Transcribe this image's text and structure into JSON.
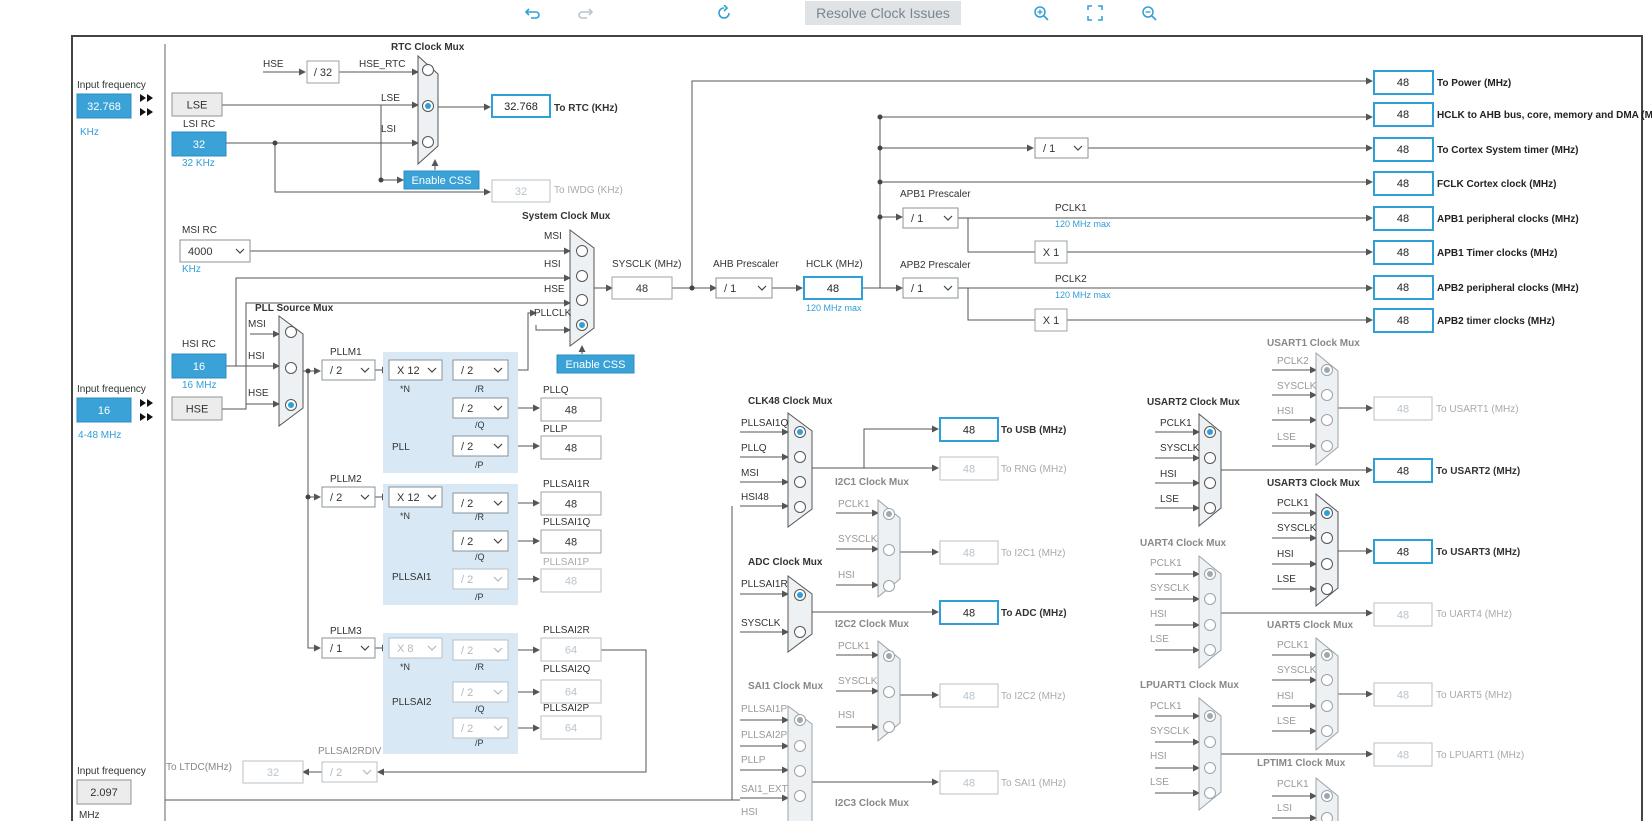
{
  "toolbar": {
    "undo_icon": "undo-icon",
    "redo_icon": "redo-icon",
    "refresh_icon": "refresh-icon",
    "resolve_label": "Resolve Clock Issues",
    "zoom_in_icon": "zoom-in-icon",
    "fit_icon": "fit-screen-icon",
    "zoom_out_icon": "zoom-out-icon"
  },
  "colors": {
    "accent": "#2f9fd8",
    "active_box": "#3aa2d7",
    "gray_box": "#ececec",
    "pll_bg": "#d8e9f5",
    "line": "#555555"
  },
  "labels": {
    "input_frequency": "Input frequency",
    "lse_freq": "32.768",
    "lse_unit": "KHz",
    "lse": "LSE",
    "lsi_rc": "LSI RC",
    "lsi_val": "32",
    "lsi_unit": "32 KHz",
    "hse": "HSE",
    "div32": "/ 32",
    "hse_rtc": "HSE_RTC",
    "lse_sig": "LSE",
    "lsi_sig": "LSI",
    "rtc_mux": "RTC Clock Mux",
    "rtc_val": "32.768",
    "to_rtc": "To RTC (KHz)",
    "enable_css": "Enable CSS",
    "iwdg_val": "32",
    "to_iwdg": "To IWDG (KHz)",
    "msi_rc": "MSI RC",
    "msi_val": "4000",
    "msi_unit": "KHz",
    "sys_mux": "System Clock Mux",
    "msi": "MSI",
    "hsi": "HSI",
    "hse_sig": "HSE",
    "pllclk": "PLLCLK",
    "sysclk": "SYSCLK (MHz)",
    "sysclk_val": "48",
    "ahb_presc": "AHB Prescaler",
    "ahb_val": "/ 1",
    "hclk": "HCLK (MHz)",
    "hclk_val": "48",
    "hclk_max": "120 MHz max",
    "apb1_presc": "APB1 Prescaler",
    "apb1_val": "/ 1",
    "apb2_presc": "APB2 Prescaler",
    "apb2_val": "/ 1",
    "pclk1": "PCLK1",
    "pclk1_max": "120 MHz max",
    "pclk2": "PCLK2",
    "pclk2_max": "120 MHz max",
    "x1": "X 1",
    "cortex_div": "/ 1",
    "hsi_rc": "HSI RC",
    "hsi_val": "16",
    "hsi_unit": "16 MHz",
    "hse_freq": "16",
    "hse_unit": "4-48 MHz",
    "pll_src_mux": "PLL Source Mux",
    "pllm1": "PLLM1",
    "pllm1_val": "/ 2",
    "pll_n_val": "X 12",
    "n_label": "*N",
    "div2": "/ 2",
    "r": "/R",
    "q": "/Q",
    "p": "/P",
    "pll": "PLL",
    "pllq": "PLLQ",
    "pllq_val": "48",
    "pllp": "PLLP",
    "pllp_val": "48",
    "pllm2": "PLLM2",
    "pllm2_val": "/ 2",
    "pllsai1_n": "X 12",
    "pllsai1": "PLLSAI1",
    "pllsai1r": "PLLSAI1R",
    "pllsai1r_val": "48",
    "pllsai1q": "PLLSAI1Q",
    "pllsai1q_val": "48",
    "pllsai1p": "PLLSAI1P",
    "pllsai1p_val": "48",
    "pllm3": "PLLM3",
    "pllm3_val": "/ 1",
    "pllsai2_n": "X 8",
    "pllsai2": "PLLSAI2",
    "pllsai2r": "PLLSAI2R",
    "pllsai2r_val": "64",
    "pllsai2q": "PLLSAI2Q",
    "pllsai2q_val": "64",
    "pllsai2p": "PLLSAI2P",
    "pllsai2p_val": "64",
    "pllsai2rdiv": "PLLSAI2RDIV",
    "pllsai2rdiv_val": "/ 2",
    "ltdc_val": "32",
    "to_ltdc": "To LTDC(MHz)",
    "input_freq3_val": "2.097",
    "mhz": "MHz",
    "clk48_mux": "CLK48 Clock Mux",
    "pllsai1q_sig": "PLLSAI1Q",
    "pllq_sig": "PLLQ",
    "msi_sig": "MSI",
    "hsi48": "HSI48",
    "usb_val": "48",
    "to_usb": "To USB (MHz)",
    "rng_val": "48",
    "to_rng": "To RNG (MHz)",
    "i2c1_mux": "I2C1 Clock Mux",
    "pclk1_sig": "PCLK1",
    "sysclk_sig": "SYSCLK",
    "hsi_sig": "HSI",
    "i2c1_val": "48",
    "to_i2c1": "To I2C1 (MHz)",
    "adc_mux": "ADC Clock Mux",
    "pllsai1r_sig": "PLLSAI1R",
    "adc_val": "48",
    "to_adc": "To ADC (MHz)",
    "i2c2_mux": "I2C2 Clock Mux",
    "i2c2_val": "48",
    "to_i2c2": "To I2C2 (MHz)",
    "sai1_mux": "SAI1 Clock Mux",
    "pllsai1p_sig": "PLLSAI1P",
    "pllsai2p_sig": "PLLSAI2P",
    "pllp_sig": "PLLP",
    "sai1_ext": "SAI1_EXT",
    "sai1_val": "48",
    "to_sai1": "To SAI1 (MHz)",
    "i2c3_mux": "I2C3 Clock Mux",
    "usart1_mux": "USART1 Clock Mux",
    "pclk2_sig": "PCLK2",
    "lse_in": "LSE",
    "usart1_val": "48",
    "to_usart1": "To USART1 (MHz)",
    "usart2_mux": "USART2 Clock Mux",
    "usart2_val": "48",
    "to_usart2": "To USART2 (MHz)",
    "usart3_mux": "USART3 Clock Mux",
    "usart3_val": "48",
    "to_usart3": "To USART3 (MHz)",
    "uart4_mux": "UART4 Clock Mux",
    "uart4_val": "48",
    "to_uart4": "To UART4 (MHz)",
    "uart5_mux": "UART5 Clock Mux",
    "uart5_val": "48",
    "to_uart5": "To UART5 (MHz)",
    "lpuart1_mux": "LPUART1 Clock Mux",
    "lpuart1_val": "48",
    "to_lpuart1": "To LPUART1 (MHz)",
    "lptim1_mux": "LPTIM1 Clock Mux",
    "lsi_in": "LSI"
  },
  "outputs": [
    {
      "value": "48",
      "label": "To Power (MHz)"
    },
    {
      "value": "48",
      "label": "HCLK to AHB bus, core, memory and DMA (MHz)"
    },
    {
      "value": "48",
      "label": "To Cortex System timer (MHz)"
    },
    {
      "value": "48",
      "label": "FCLK Cortex clock (MHz)"
    },
    {
      "value": "48",
      "label": "APB1 peripheral clocks (MHz)"
    },
    {
      "value": "48",
      "label": "APB1 Timer clocks (MHz)"
    },
    {
      "value": "48",
      "label": "APB2 peripheral clocks (MHz)"
    },
    {
      "value": "48",
      "label": "APB2 timer clocks (MHz)"
    }
  ]
}
